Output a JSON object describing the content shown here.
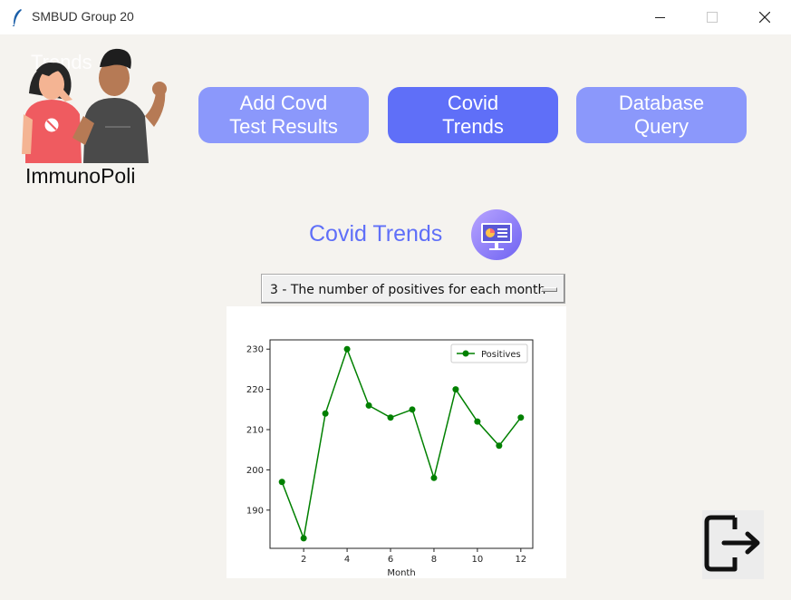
{
  "window": {
    "title": "SMBUD Group 20",
    "controls": {
      "minimize": "minimize-icon",
      "maximize": "maximize-icon",
      "close": "close-icon"
    }
  },
  "header": {
    "ghost_text": "Trends",
    "brand": "ImmunoPoli",
    "illustration": "two-people-flexing-illustration"
  },
  "nav": {
    "buttons": [
      {
        "label": "Add Covd\nTest Results",
        "active": false
      },
      {
        "label": "Covid\nTrends",
        "active": true
      },
      {
        "label": "Database\nQuery",
        "active": false
      }
    ]
  },
  "section": {
    "title": "Covid Trends",
    "icon": "presentation-board-icon"
  },
  "query_select": {
    "value": "3 - The number of positives for each month"
  },
  "chart_data": {
    "type": "line",
    "x": [
      1,
      2,
      3,
      4,
      5,
      6,
      7,
      8,
      9,
      10,
      11,
      12
    ],
    "series": [
      {
        "name": "Positives",
        "values": [
          197,
          183,
          214,
          230,
          216,
          213,
          215,
          198,
          220,
          212,
          206,
          213
        ],
        "color": "#008000"
      }
    ],
    "xlabel": "Month",
    "ylabel": "",
    "xticks": [
      2,
      4,
      6,
      8,
      10,
      12
    ],
    "yticks": [
      190,
      200,
      210,
      220,
      230
    ],
    "xlim": [
      0.45,
      12.55
    ],
    "ylim": [
      180.5,
      232.3
    ],
    "legend": "top-right",
    "grid": false
  },
  "footer": {
    "logout_icon": "logout-icon"
  }
}
